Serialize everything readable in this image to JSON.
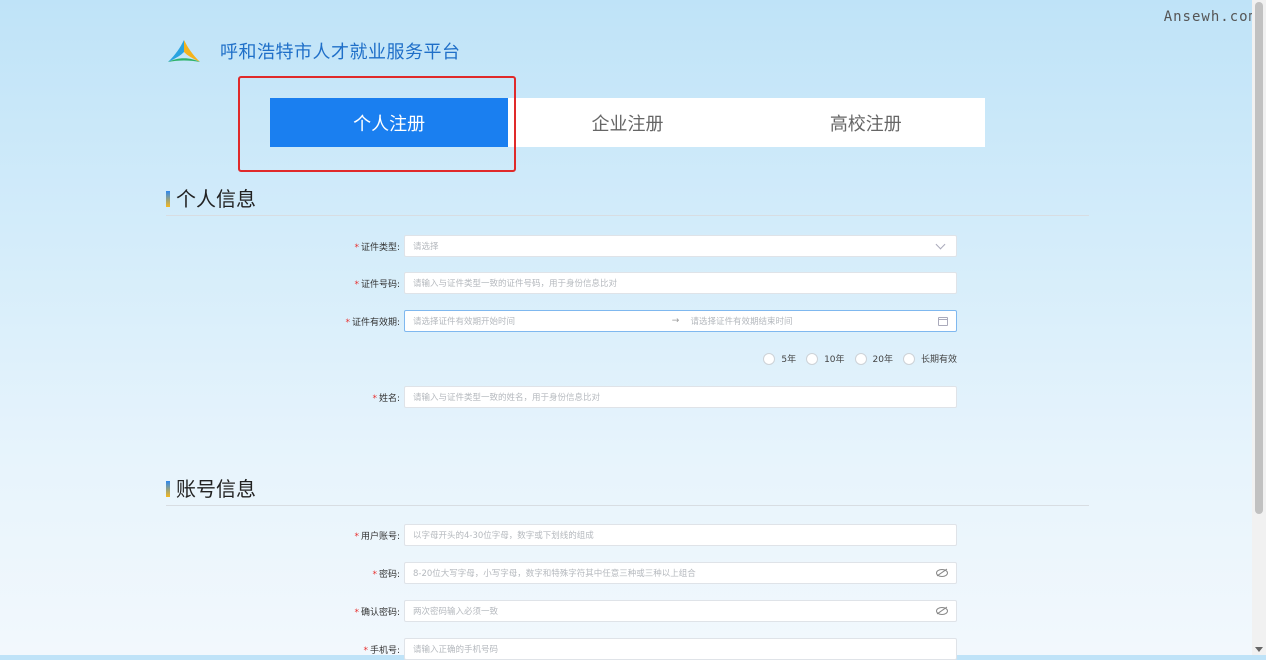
{
  "watermark": "Ansewh.com",
  "brand": {
    "title": "呼和浩特市人才就业服务平台"
  },
  "tabs": [
    {
      "label": "个人注册",
      "active": true
    },
    {
      "label": "企业注册",
      "active": false
    },
    {
      "label": "高校注册",
      "active": false
    }
  ],
  "sections": {
    "personal": {
      "title": "个人信息"
    },
    "account": {
      "title": "账号信息"
    }
  },
  "required_mark": "*",
  "personal_fields": {
    "id_type": {
      "label": "证件类型:",
      "placeholder": "请选择"
    },
    "id_number": {
      "label": "证件号码:",
      "placeholder": "请输入与证件类型一致的证件号码，用于身份信息比对"
    },
    "validity": {
      "label": "证件有效期:",
      "start_placeholder": "请选择证件有效期开始时间",
      "separator": "→",
      "end_placeholder": "请选择证件有效期结束时间"
    },
    "validity_options": [
      "5年",
      "10年",
      "20年",
      "长期有效"
    ],
    "name": {
      "label": "姓名:",
      "placeholder": "请输入与证件类型一致的姓名，用于身份信息比对"
    }
  },
  "account_fields": {
    "username": {
      "label": "用户账号:",
      "placeholder": "以字母开头的4-30位字母，数字或下划线的组成"
    },
    "password": {
      "label": "密码:",
      "placeholder": "8-20位大写字母，小写字母，数字和特殊字符其中任意三种或三种以上组合"
    },
    "confirm_password": {
      "label": "确认密码:",
      "placeholder": "两次密码输入必须一致"
    },
    "phone": {
      "label": "手机号:",
      "placeholder": "请输入正确的手机号码"
    }
  },
  "colors": {
    "accent": "#1a7ff0",
    "required": "#e8312f",
    "highlight": "#e02a2a",
    "brand": "#1f6fc8"
  },
  "icons": [
    "triangle-logo-icon",
    "chevron-down-icon",
    "arrow-right-icon",
    "calendar-icon",
    "eye-off-icon"
  ]
}
